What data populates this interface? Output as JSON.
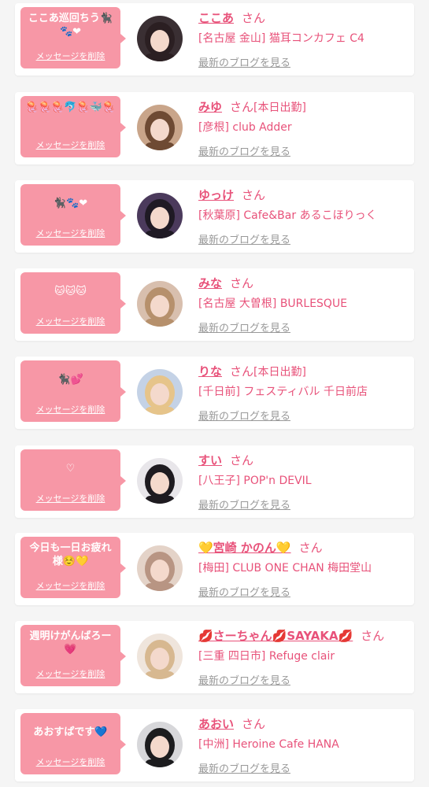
{
  "common": {
    "delete_label": "メッセージを削除",
    "blog_label": "最新のブログを見る",
    "san_label": "さん"
  },
  "items": [
    {
      "message": "ここあ巡回ちう🐈‍⬛🐾❤",
      "name": "ここあ",
      "work": "",
      "shop": "[名古屋 金山] 猫耳コンカフェ C4",
      "avatar_bg": "#3a2f33",
      "avatar_hair": "#2b1f22"
    },
    {
      "message": "🪼🪼🪼🐬🪼🐳🪼",
      "name": "みゆ",
      "work": "[本日出勤]",
      "shop": "[彦根] club Adder",
      "avatar_bg": "#c9a58a",
      "avatar_hair": "#6e4a33"
    },
    {
      "message": "🐈‍⬛🐾❤",
      "name": "ゆっけ",
      "work": "",
      "shop": "[秋葉原] Cafe&Bar あるこほりっく",
      "avatar_bg": "#4b3a5c",
      "avatar_hair": "#1f1a24"
    },
    {
      "message": "🐱🐱🐱",
      "name": "みな",
      "work": "",
      "shop": "[名古屋 大曽根] BURLESQUE",
      "avatar_bg": "#d8bfae",
      "avatar_hair": "#b6906c"
    },
    {
      "message": "🐈‍⬛💕",
      "name": "りな",
      "work": "[本日出勤]",
      "shop": "[千日前] フェスティバル 千日前店",
      "avatar_bg": "#c4d2e6",
      "avatar_hair": "#e6c48a"
    },
    {
      "message": "♡",
      "name": "すい",
      "work": "",
      "shop": "[八王子] POP'n DEVIL",
      "avatar_bg": "#e8e6ea",
      "avatar_hair": "#1e1b20"
    },
    {
      "message": "今日も一日お疲れ様☺️💛",
      "name": "💛宮崎 かのん💛",
      "work": "",
      "shop": "[梅田] CLUB ONE CHAN 梅田堂山",
      "avatar_bg": "#e4d3c8",
      "avatar_hair": "#b89583"
    },
    {
      "message": "週明けがんばろー💗",
      "name": "💋さーちゃん💋SAYAKA💋",
      "work": "",
      "shop": "[三重 四日市] Refuge clair",
      "avatar_bg": "#efe5dc",
      "avatar_hair": "#d7b890"
    },
    {
      "message": "あおすぱです💙",
      "name": "あおい",
      "work": "",
      "shop": "[中洲] Heroine Cafe HANA",
      "avatar_bg": "#d7d7da",
      "avatar_hair": "#1c1c1e"
    }
  ]
}
